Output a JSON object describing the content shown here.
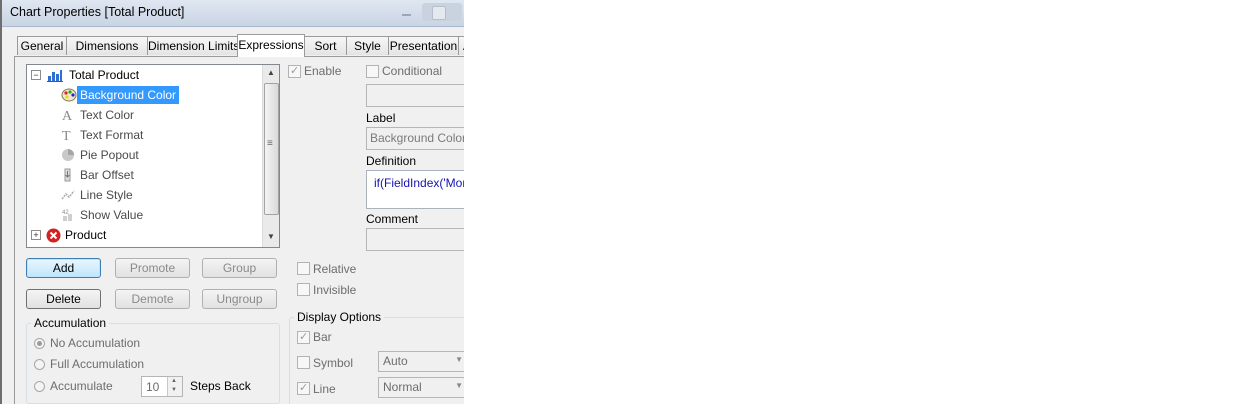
{
  "window": {
    "title": "Chart Properties [Total Product]"
  },
  "tabs": [
    {
      "label": "General",
      "active": false
    },
    {
      "label": "Dimensions",
      "active": false
    },
    {
      "label": "Dimension Limits",
      "active": false
    },
    {
      "label": "Expressions",
      "active": true
    },
    {
      "label": "Sort",
      "active": false
    },
    {
      "label": "Style",
      "active": false
    },
    {
      "label": "Presentation",
      "active": false
    },
    {
      "label": "Ax",
      "active": false
    }
  ],
  "tree": {
    "root": {
      "label": "Total Product",
      "expanded": true,
      "icon": "bar-chart-icon"
    },
    "children": [
      {
        "label": "Background Color",
        "icon": "palette-icon",
        "selected": true
      },
      {
        "label": "Text Color",
        "icon": "text-a-icon"
      },
      {
        "label": "Text Format",
        "icon": "text-t-icon"
      },
      {
        "label": "Pie Popout",
        "icon": "pie-icon"
      },
      {
        "label": "Bar Offset",
        "icon": "bar-offset-icon"
      },
      {
        "label": "Line Style",
        "icon": "line-style-icon"
      },
      {
        "label": "Show Value",
        "icon": "show-value-icon"
      }
    ],
    "second": {
      "label": "Product",
      "expanded": false,
      "icon": "error-x-icon"
    },
    "show_value_icon_text": "42"
  },
  "buttons": {
    "add": "Add",
    "promote": "Promote",
    "group": "Group",
    "delete": "Delete",
    "demote": "Demote",
    "ungroup": "Ungroup"
  },
  "accumulation": {
    "title": "Accumulation",
    "options": [
      {
        "label": "No Accumulation",
        "checked": true
      },
      {
        "label": "Full Accumulation",
        "checked": false
      },
      {
        "label": "Accumulate",
        "checked": false
      }
    ],
    "steps_value": "10",
    "steps_label": "Steps Back"
  },
  "expression": {
    "enable_label": "Enable",
    "enable_checked": true,
    "conditional_label": "Conditional",
    "conditional_checked": false,
    "label_caption": "Label",
    "label_value": "Background Color",
    "definition_caption": "Definition",
    "definition_value": "if(FieldIndex('Mon",
    "comment_caption": "Comment"
  },
  "flags": {
    "relative_label": "Relative",
    "relative_checked": false,
    "invisible_label": "Invisible",
    "invisible_checked": false
  },
  "display_options": {
    "title": "Display Options",
    "bar_label": "Bar",
    "bar_checked": true,
    "symbol_label": "Symbol",
    "symbol_checked": false,
    "symbol_value": "Auto",
    "line_label": "Line",
    "line_checked": true,
    "line_value": "Normal"
  }
}
